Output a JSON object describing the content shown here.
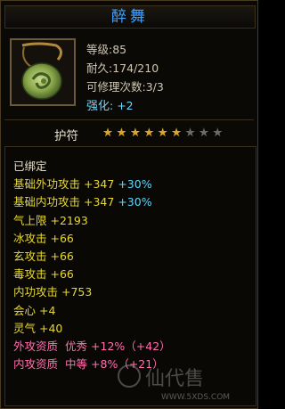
{
  "title": "醉舞",
  "item": {
    "icon": "jade-pendant-icon",
    "stats": [
      {
        "label": "等级",
        "value": "85"
      },
      {
        "label": "耐久",
        "value": "174/210"
      },
      {
        "label": "可修理次数",
        "value": "3/3"
      },
      {
        "label": "强化",
        "value": "+2"
      }
    ]
  },
  "hufu": {
    "label": "护符",
    "stars_filled": 6,
    "stars_total": 9
  },
  "bound_text": "已绑定",
  "attributes": [
    {
      "name": "基础外功攻击",
      "value": "+347",
      "pct": "+30%"
    },
    {
      "name": "基础内功攻击",
      "value": "+347",
      "pct": "+30%"
    },
    {
      "name": "气上限",
      "value": "+2193"
    },
    {
      "name": "冰攻击",
      "value": "+66"
    },
    {
      "name": "玄攻击",
      "value": "+66"
    },
    {
      "name": "毒攻击",
      "value": "+66"
    },
    {
      "name": "内功攻击",
      "value": "+753"
    },
    {
      "name": "会心",
      "value": "+4"
    },
    {
      "name": "灵气",
      "value": "+40"
    }
  ],
  "aptitudes": [
    {
      "name": "外攻资质",
      "grade": "优秀",
      "value": "+12%（+42）"
    },
    {
      "name": "内攻资质",
      "grade": "中等",
      "value": "+8%（+21）"
    }
  ],
  "watermark": {
    "text": "仙代售",
    "url": "WWW.5XDS.COM"
  },
  "colors": {
    "title": "#3fa0ff",
    "attribute": "#e6d830",
    "percent": "#5fd7ff",
    "aptitude": "#ff6fae",
    "star_on": "#d9a52a",
    "star_off": "#6b6b6b"
  }
}
